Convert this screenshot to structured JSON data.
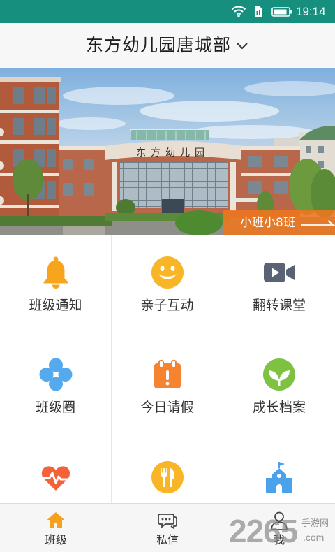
{
  "status_bar": {
    "time": "19:14",
    "icons": [
      "wifi-icon",
      "sim-card-icon",
      "battery-icon"
    ],
    "background": "#178f7f"
  },
  "header": {
    "title": "东方幼儿园唐城部",
    "dropdown_icon": "chevron-down-icon"
  },
  "banner": {
    "building_sign": "东方幼儿园",
    "class_label": "小班小8班",
    "class_arrow_icon": "long-arrow-right-icon",
    "label_color": "#ee761e"
  },
  "grid": {
    "items": [
      {
        "label": "班级通知",
        "icon": "bell-icon",
        "color": "#f7a51c"
      },
      {
        "label": "亲子互动",
        "icon": "smiley-icon",
        "color": "#f8b526"
      },
      {
        "label": "翻转课堂",
        "icon": "video-camera-icon",
        "color": "#5a6375"
      },
      {
        "label": "班级圈",
        "icon": "flower-icon",
        "color": "#55aaee"
      },
      {
        "label": "今日请假",
        "icon": "calendar-alert-icon",
        "color": "#f5832f"
      },
      {
        "label": "成长档案",
        "icon": "sprout-icon",
        "color": "#7ec242"
      },
      {
        "icon": "heart-pulse-icon",
        "color": "#f4623a"
      },
      {
        "icon": "fork-knife-icon",
        "color": "#f8b526"
      },
      {
        "icon": "school-icon",
        "color": "#4aa3ea"
      }
    ]
  },
  "tab_bar": {
    "active_color": "#f5a01f",
    "tabs": [
      {
        "label": "班级",
        "icon": "home-icon",
        "active": true
      },
      {
        "label": "私信",
        "icon": "chat-icon",
        "active": false
      },
      {
        "label": "我",
        "icon": "person-icon",
        "active": false
      }
    ]
  },
  "watermark": {
    "number": "2265",
    "site": "手游网",
    "domain": ".com"
  }
}
